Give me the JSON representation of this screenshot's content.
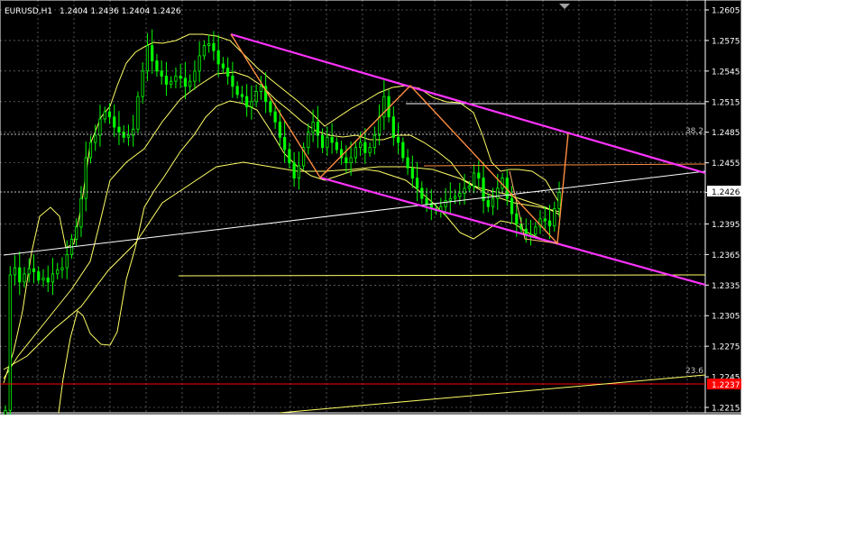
{
  "header": {
    "symbol": "EURUSD,H1",
    "quote": "1.2404 1.2436 1.2404 1.2426"
  },
  "colors": {
    "background": "#000000",
    "grid": "#ffffff",
    "candles": "#00ff00",
    "bands": "#ffff66",
    "channel": "#ff33ff",
    "zigzag": "#ff8c40",
    "trendline": "#ffffff",
    "support_line": "#ff0000",
    "current_price_badge": "#ffffff"
  },
  "chart_data": {
    "type": "candlestick",
    "symbol": "EURUSD",
    "timeframe": "H1",
    "ylim": [
      1.2215,
      1.2605
    ],
    "y_ticks": [
      "1.2605",
      "1.2575",
      "1.2545",
      "1.2515",
      "1.2485",
      "1.2455",
      "1.2426",
      "1.2395",
      "1.2365",
      "1.2335",
      "1.2305",
      "1.2275",
      "1.2245",
      "1.2215"
    ],
    "grid": true,
    "current_price": "1.2426",
    "level_badge": "1.2237",
    "fib_labels": [
      "38.2",
      "23.6"
    ],
    "closes": [
      1.2212,
      1.2345,
      1.2352,
      1.2338,
      1.2346,
      1.2351,
      1.2348,
      1.234,
      1.2342,
      1.2338,
      1.2346,
      1.235,
      1.2352,
      1.2365,
      1.238,
      1.2392,
      1.242,
      1.246,
      1.2475,
      1.2482,
      1.2498,
      1.2505,
      1.25,
      1.249,
      1.2485,
      1.248,
      1.2482,
      1.2488,
      1.252,
      1.2545,
      1.257,
      1.2555,
      1.2545,
      1.254,
      1.2532,
      1.2535,
      1.254,
      1.2538,
      1.253,
      1.2535,
      1.2545,
      1.256,
      1.257,
      1.2572,
      1.2565,
      1.2552,
      1.2548,
      1.254,
      1.253,
      1.2522,
      1.252,
      1.251,
      1.2515,
      1.2525,
      1.253,
      1.2515,
      1.2505,
      1.2495,
      1.248,
      1.2468,
      1.2455,
      1.244,
      1.2452,
      1.247,
      1.2485,
      1.2495,
      1.2482,
      1.247,
      1.248,
      1.2475,
      1.2468,
      1.246,
      1.2455,
      1.246,
      1.247,
      1.2475,
      1.2465,
      1.247,
      1.2482,
      1.25,
      1.252,
      1.25,
      1.248,
      1.2475,
      1.246,
      1.245,
      1.244,
      1.243,
      1.242,
      1.2415,
      1.241,
      1.2408,
      1.2412,
      1.2418,
      1.242,
      1.2422,
      1.2425,
      1.243,
      1.2432,
      1.2445,
      1.244,
      1.2418,
      1.2412,
      1.242,
      1.243,
      1.244,
      1.242,
      1.2405,
      1.2395,
      1.239,
      1.2385,
      1.2385,
      1.2392,
      1.24,
      1.2398,
      1.2393,
      1.241,
      1.2426
    ]
  }
}
